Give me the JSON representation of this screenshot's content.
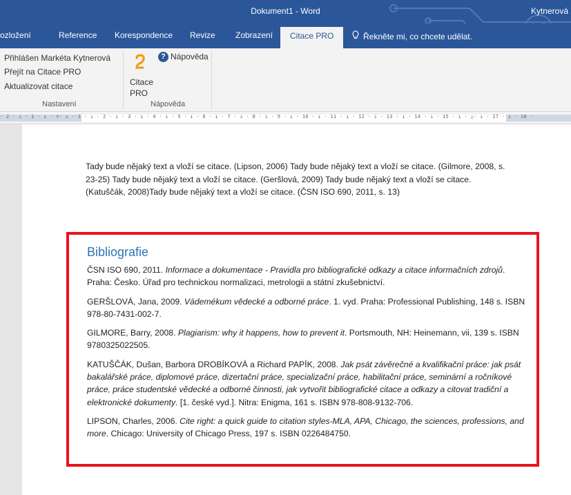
{
  "window": {
    "title": "Dokument1  -  Word",
    "user": "Kytnerová"
  },
  "tabs": [
    {
      "label": "ozložení"
    },
    {
      "label": "Reference"
    },
    {
      "label": "Korespondence"
    },
    {
      "label": "Revize"
    },
    {
      "label": "Zobrazení"
    },
    {
      "label": "Citace PRO",
      "active": true
    },
    {
      "label": "Řekněte mi, co chcete udělat."
    }
  ],
  "ribbon": {
    "nastaveni": {
      "items": [
        "Přihlášen Markéta Kytnerová",
        "Přejít na Citace PRO",
        "Aktualizovat citace"
      ],
      "group_label": "Nastavení"
    },
    "napoveda": {
      "citace_line1": "Citace",
      "citace_line2": "PRO",
      "help_label": "Nápověda",
      "group_label": "Nápověda"
    }
  },
  "ruler": {
    "ticks": "· 2 · ı · 1 · ı · ▽· ı · 1 · ı · 2 · ı · 3 · ı · 4 · ı · 5 · ı · 6 · ı · 7 · ı · 8 · ı · 9 · ı · 10 · ı · 11 · ı · 12 · ı · 13 · ı · 14 · ı · 15 · ı · △· ı · 17 · ı · 18 ·"
  },
  "document": {
    "paragraph": "Tady bude nějaký text a vloží se citace. (Lipson, 2006) Tady bude nějaký text a vloží se citace. (Gilmore, 2008, s. 23-25) Tady bude nějaký text a vloží se citace. (Geršlová, 2009) Tady bude nějaký text a vloží se citace. (Katuščák, 2008)Tady bude nějaký text a vloží se citace. (ČSN ISO 690, 2011, s. 13)",
    "bibliography_title": "Bibliografie",
    "entries": [
      {
        "pre": "ČSN ISO 690, 2011. ",
        "title": "Informace a dokumentace - Pravidla pro bibliografické odkazy a citace informačních zdrojů",
        "post": ". Praha: Česko. Úřad pro technickou normalizaci, metrologii a státní zkušebnictví."
      },
      {
        "pre": "GERŠLOVÁ, Jana, 2009. ",
        "title": "Vádemékum vědecké a odborné práce",
        "post": ". 1. vyd. Praha: Professional Publishing, 148 s. ISBN 978-80-7431-002-7."
      },
      {
        "pre": "GILMORE, Barry, 2008. ",
        "title": "Plagiarism: why it happens, how to prevent it",
        "post": ". Portsmouth, NH: Heinemann, vii, 139 s. ISBN 9780325022505."
      },
      {
        "pre": "KATUŠČÁK, Dušan, Barbora DROBÍKOVÁ a Richard PAPÍK, 2008. ",
        "title": "Jak psát závěrečné a kvalifikační práce: jak psát bakalářské práce, diplomové práce, dizertační práce, specializační práce, habilitační práce, seminární a ročníkové práce, práce studentské vědecké a odborné činnosti, jak vytvořit bibliografické citace a odkazy a citovat tradiční a elektronické dokumenty",
        "post": ". [1. české vyd.]. Nitra: Enigma, 161 s. ISBN 978-808-9132-706."
      },
      {
        "pre": "LIPSON, Charles, 2006. ",
        "title": "Cite right: a quick guide to citation styles-MLA, APA, Chicago, the sciences, professions, and more",
        "post": ". Chicago: University of Chicago Press, 197 s. ISBN 0226484750."
      }
    ]
  },
  "colors": {
    "word_blue": "#2b579a",
    "ribbon_bg": "#f3f3f3",
    "heading_blue": "#2e74b5",
    "highlight_red": "#e8141c",
    "citace_icon_orange": "#f39c12"
  },
  "icons": [
    "lightbulb-icon",
    "citace-pro-icon",
    "help-icon",
    "circuit-decoration"
  ]
}
